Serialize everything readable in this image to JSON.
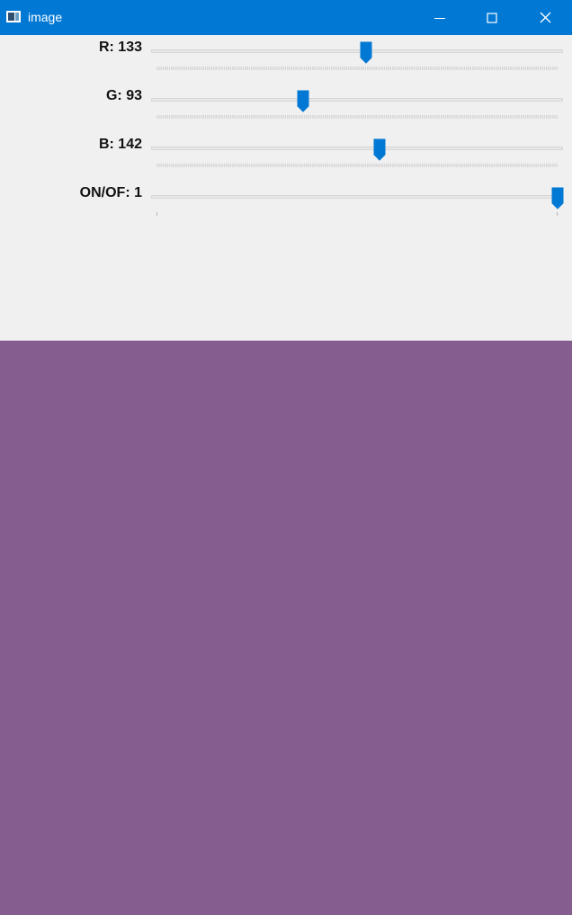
{
  "window": {
    "title": "image",
    "icon": "opencv-window-icon",
    "buttons": [
      "minimize-icon",
      "maximize-icon",
      "close-icon"
    ],
    "titlebar_color": "#0078d4"
  },
  "trackbars": [
    {
      "id": "r",
      "label": "R: 133",
      "value": 133,
      "max": 255
    },
    {
      "id": "g",
      "label": "G: 93",
      "value": 93,
      "max": 255
    },
    {
      "id": "b",
      "label": "B: 142",
      "value": 142,
      "max": 255
    },
    {
      "id": "onoff",
      "label": "ON/OF: 1",
      "value": 1,
      "max": 1
    }
  ],
  "preview": {
    "color": "#855d8e"
  },
  "accent_color": "#0078d4"
}
